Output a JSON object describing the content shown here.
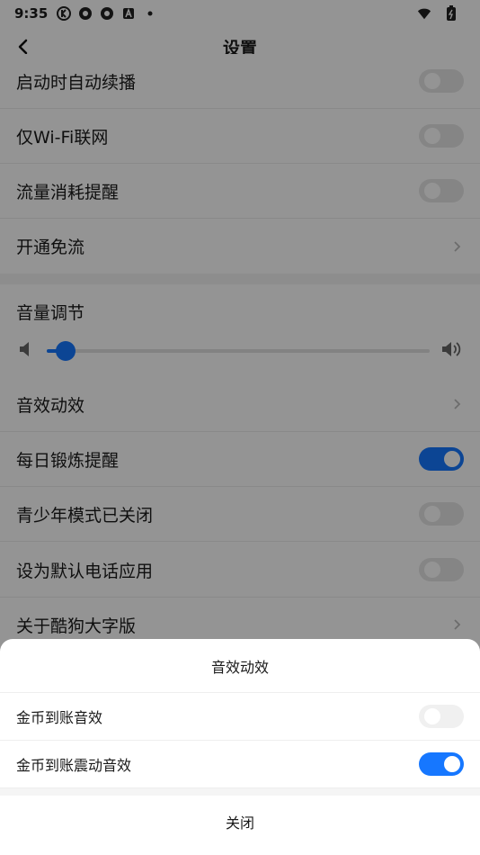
{
  "status": {
    "time": "9:35"
  },
  "appbar": {
    "title": "设置"
  },
  "settings": {
    "rows": [
      {
        "label": "启动时自动续播",
        "type": "toggle",
        "on": false
      },
      {
        "label": "仅Wi-Fi联网",
        "type": "toggle",
        "on": false
      },
      {
        "label": "流量消耗提醒",
        "type": "toggle",
        "on": false
      },
      {
        "label": "开通免流",
        "type": "chevron"
      }
    ],
    "volume": {
      "title": "音量调节",
      "level": 0.05
    },
    "rows2": [
      {
        "label": "音效动效",
        "type": "chevron"
      },
      {
        "label": "每日锻炼提醒",
        "type": "toggle",
        "on": true
      },
      {
        "label": "青少年模式已关闭",
        "type": "toggle",
        "on": false
      },
      {
        "label": "设为默认电话应用",
        "type": "toggle",
        "on": false
      },
      {
        "label": "关于酷狗大字版",
        "type": "chevron"
      }
    ]
  },
  "sheet": {
    "title": "音效动效",
    "items": [
      {
        "label": "金币到账音效",
        "on": false
      },
      {
        "label": "金币到账震动音效",
        "on": true
      }
    ],
    "close_label": "关闭"
  },
  "colors": {
    "accent": "#1677ff",
    "overlay": "rgba(0,0,0,0.42)"
  }
}
